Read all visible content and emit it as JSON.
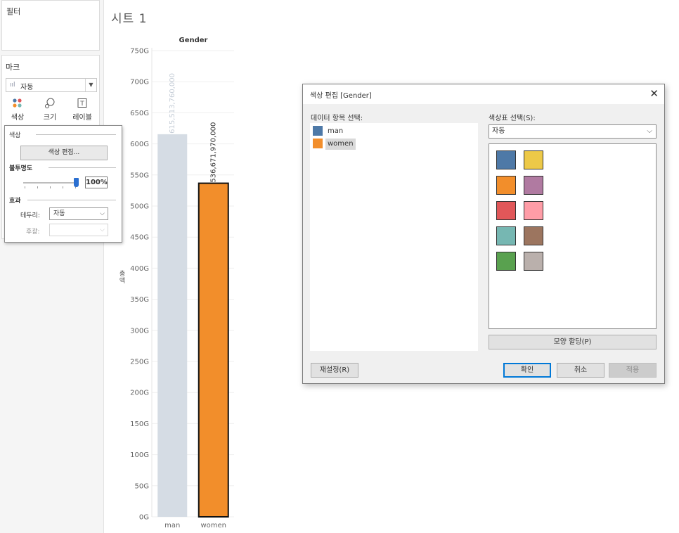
{
  "left_pane": {
    "filters_title": "필터",
    "marks_title": "마크",
    "mark_type": "자동",
    "mark_buttons": [
      {
        "label": "색상",
        "icon": "color-dots-icon"
      },
      {
        "label": "크기",
        "icon": "size-icon"
      },
      {
        "label": "레이블",
        "icon": "label-icon"
      }
    ]
  },
  "color_popup": {
    "color_title": "색상",
    "edit_colors": "색상 편집...",
    "opacity_title": "불투명도",
    "opacity_value": "100%",
    "opacity_level": 100,
    "effects_title": "효과",
    "border_label": "테두리:",
    "border_value": "자동",
    "halo_label": "후광:",
    "halo_value": ""
  },
  "sheet_title": "시트 1",
  "chart_data": {
    "type": "bar",
    "title": "Gender",
    "categories": [
      "man",
      "women"
    ],
    "values": [
      615513760000,
      536671970000
    ],
    "data_labels": [
      "615,513,760,000",
      "536,671,970,000"
    ],
    "colors": [
      "#d5dce4",
      "#f28e2b"
    ],
    "ylabel": "총액",
    "ylim": [
      0,
      750000000000
    ],
    "ticks": [
      "0G",
      "50G",
      "100G",
      "150G",
      "200G",
      "250G",
      "300G",
      "350G",
      "400G",
      "450G",
      "500G",
      "550G",
      "600G",
      "650G",
      "700G",
      "750G"
    ],
    "grid": true,
    "highlighted": "women"
  },
  "dialog": {
    "title": "색상 편집 [Gender]",
    "items_label": "데이터 항목 선택:",
    "items": [
      {
        "name": "man",
        "color": "#4e79a7",
        "selected": false
      },
      {
        "name": "women",
        "color": "#f28e2b",
        "selected": true
      }
    ],
    "palette_label": "색상표 선택(S):",
    "palette_value": "자동",
    "palette": [
      "#4e79a7",
      "#edc948",
      "#f28e2b",
      "#b07aa1",
      "#e15759",
      "#ff9da7",
      "#76b7b2",
      "#9c755f",
      "#59a14f",
      "#bab0ac"
    ],
    "assign_button": "모양 할당(P)",
    "reset_button": "재설정(R)",
    "ok_button": "확인",
    "cancel_button": "취소",
    "apply_button": "적용"
  }
}
